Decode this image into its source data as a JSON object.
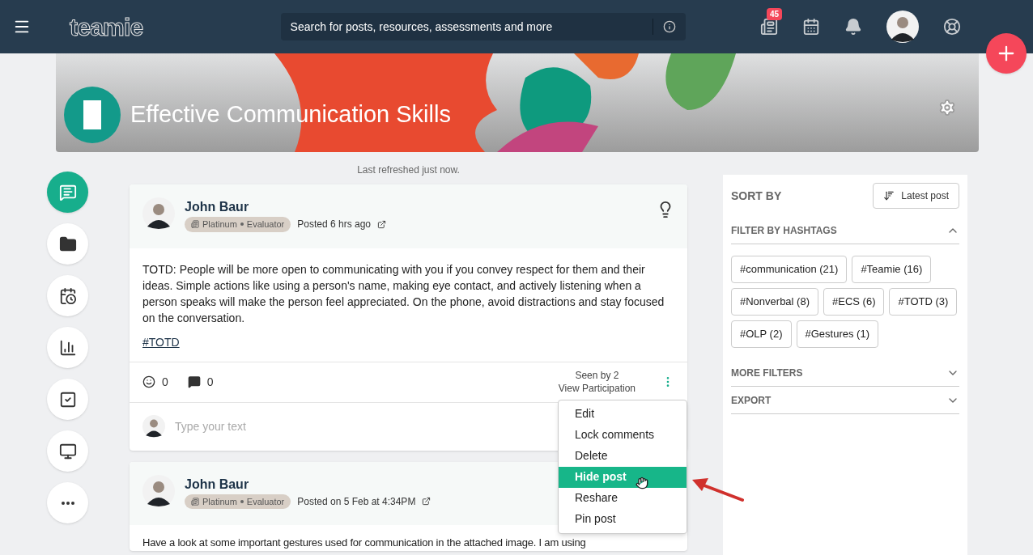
{
  "header": {
    "logo": "teamie",
    "search": {
      "placeholder": "Search for posts, resources, assessments and more"
    },
    "notification_count": "45"
  },
  "classroom": {
    "title": "Effective Communication Skills"
  },
  "rail": [
    {
      "kind": "posts",
      "selected": true
    },
    {
      "kind": "folder",
      "selected": false
    },
    {
      "kind": "calendar",
      "selected": false
    },
    {
      "kind": "chart",
      "selected": false
    },
    {
      "kind": "check",
      "selected": false
    },
    {
      "kind": "monitor",
      "selected": false
    },
    {
      "kind": "more",
      "selected": false
    }
  ],
  "refresh_note": "Last refreshed just now.",
  "posts": [
    {
      "author": "John Baur",
      "tier": "Platinum",
      "role": "Evaluator",
      "posted": "Posted 6 hrs ago",
      "body": "TOTD: People will be more open to communicating with you if you convey respect for them and their ideas. Simple actions like using a person's name, making eye contact, and actively listening when a person speaks will make the person feel appreciated. On the phone, avoid distractions and stay focused on the conversation.",
      "hashtag": "#TOTD",
      "reactions": "0",
      "comments": "0",
      "seen": "Seen by 2",
      "participation": "View Participation",
      "comment_placeholder": "Type your text"
    },
    {
      "author": "John Baur",
      "tier": "Platinum",
      "role": "Evaluator",
      "posted": "Posted on 5 Feb at 4:34PM",
      "body": "Have a look at some important gestures used for communication in the attached image. I am using"
    }
  ],
  "post_menu": [
    {
      "label": "Edit",
      "selected": false
    },
    {
      "label": "Lock comments",
      "selected": false
    },
    {
      "label": "Delete",
      "selected": false
    },
    {
      "label": "Hide post",
      "selected": true
    },
    {
      "label": "Reshare",
      "selected": false
    },
    {
      "label": "Pin post",
      "selected": false
    }
  ],
  "sidebar": {
    "sort_label": "SORT BY",
    "sort_button": "Latest post",
    "sections": [
      {
        "title": "FILTER BY HASHTAGS",
        "expanded": true,
        "tags": [
          "#communication (21)",
          "#Teamie (16)",
          "#Nonverbal (8)",
          "#ECS (6)",
          "#TOTD (3)",
          "#OLP (2)",
          "#Gestures (1)"
        ]
      },
      {
        "title": "MORE FILTERS",
        "expanded": false
      },
      {
        "title": "EXPORT",
        "expanded": false
      }
    ]
  }
}
